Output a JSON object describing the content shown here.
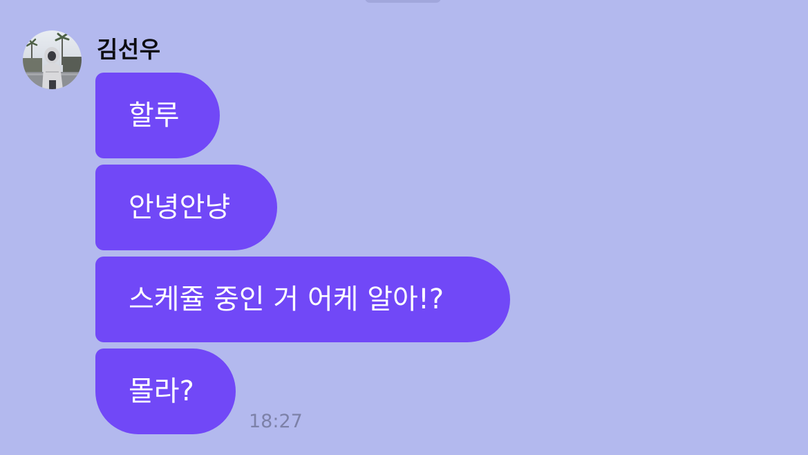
{
  "chat": {
    "sender": {
      "name": "김선우",
      "avatar_icon": "profile-photo-icon"
    },
    "messages": [
      {
        "text": "할루"
      },
      {
        "text": "안녕안냥"
      },
      {
        "text": "스케쥴 중인 거 어케 알아!?"
      },
      {
        "text": "몰라?"
      }
    ],
    "timestamp": "18:27"
  },
  "colors": {
    "background": "#b3b9ee",
    "bubble": "#7148f7",
    "bubble_text": "#ffffff",
    "name_text": "#0c0c10",
    "timestamp_text": "#7d81a8"
  }
}
